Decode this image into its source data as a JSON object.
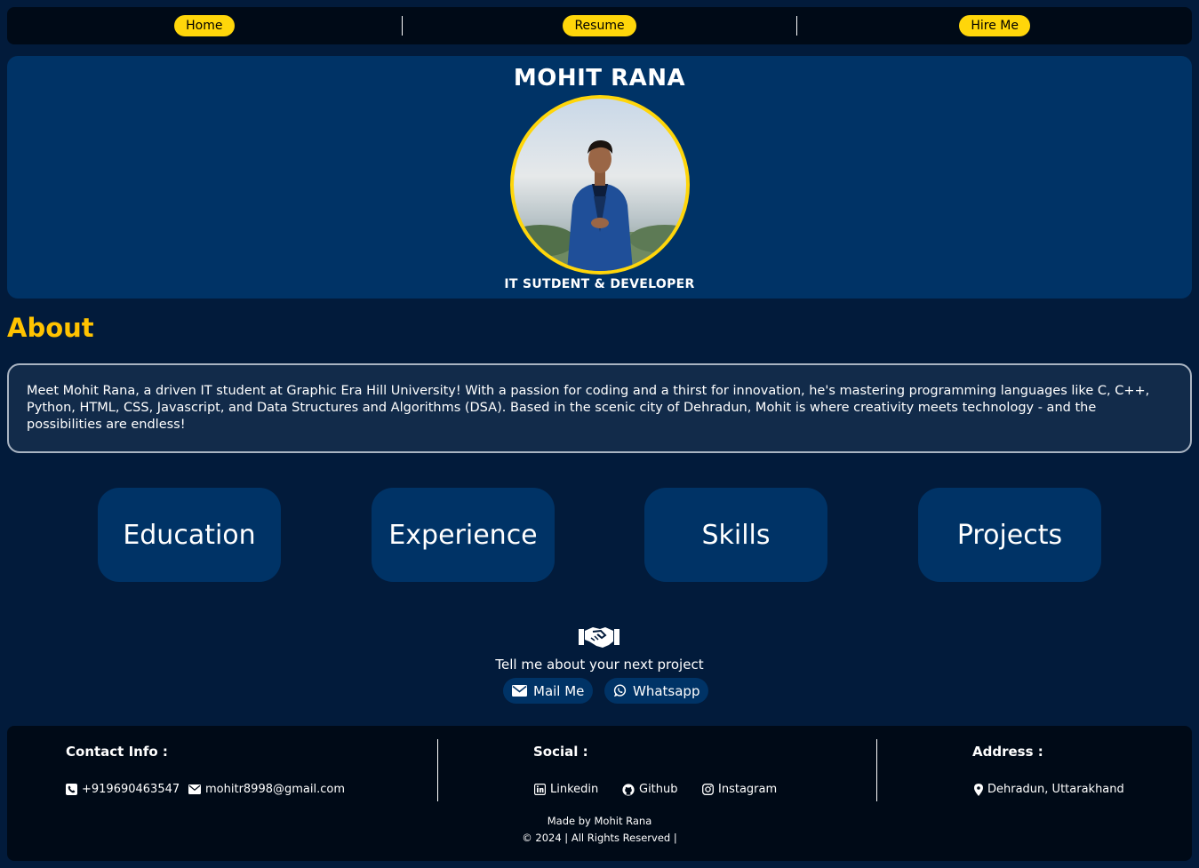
{
  "nav": {
    "items": [
      {
        "label": "Home"
      },
      {
        "label": "Resume"
      },
      {
        "label": "Hire Me"
      }
    ]
  },
  "hero": {
    "name": "MOHIT RANA",
    "role": "IT SUTDENT & DEVELOPER"
  },
  "about": {
    "title": "About",
    "text": "Meet Mohit Rana, a driven IT student at Graphic Era Hill University! With a passion for coding and a thirst for innovation, he's mastering programming languages like C, C++, Python, HTML, CSS, Javascript, and Data Structures and Algorithms (DSA). Based in the scenic city of Dehradun, Mohit is where creativity meets technology - and the possibilities are endless!"
  },
  "sections": [
    {
      "label": "Education"
    },
    {
      "label": "Experience"
    },
    {
      "label": "Skills"
    },
    {
      "label": "Projects"
    }
  ],
  "cta": {
    "icon": "handshake-icon",
    "text": "Tell me about your next project",
    "mail_label": "Mail Me",
    "whatsapp_label": "Whatsapp"
  },
  "footer": {
    "contact_title": "Contact Info :",
    "phone": "+919690463547",
    "email": "mohitr8998@gmail.com",
    "social_title": "Social :",
    "social": [
      {
        "label": "Linkedin",
        "icon": "linkedin-icon"
      },
      {
        "label": "Github",
        "icon": "github-icon"
      },
      {
        "label": "Instagram",
        "icon": "instagram-icon"
      }
    ],
    "address_title": "Address :",
    "address": "Dehradun, Uttarakhand",
    "made_by": "Made by Mohit Rana",
    "rights": "© 2024 | All Rights Reserved |"
  },
  "colors": {
    "background": "#021b3b",
    "card": "#003366",
    "accent": "#ffd60a",
    "footer": "#000a17"
  }
}
